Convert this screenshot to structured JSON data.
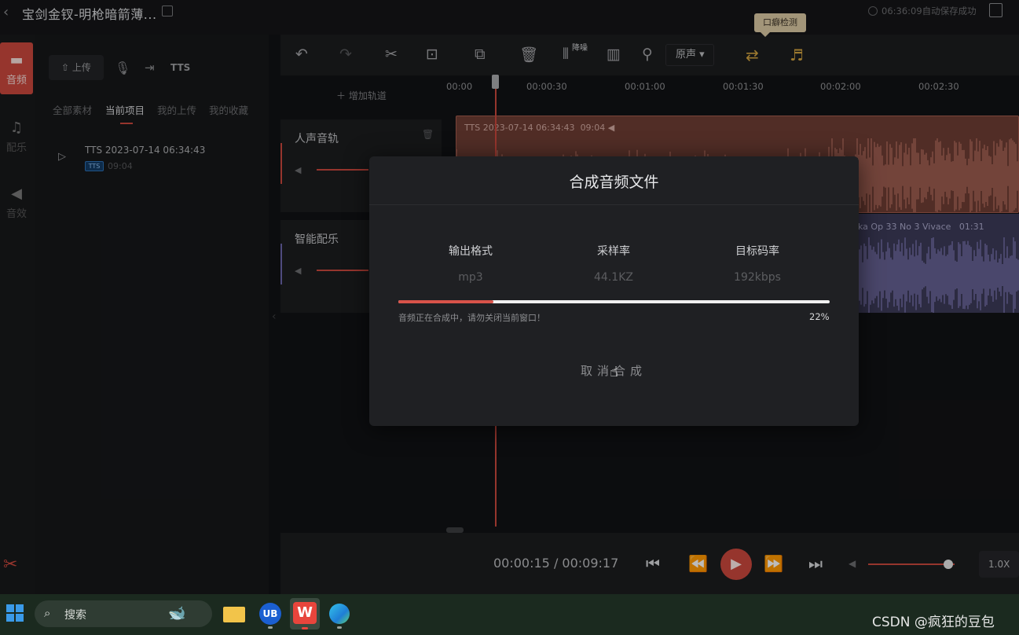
{
  "header": {
    "title": "宝剑金钗-明枪暗箭薄...",
    "save_status": "06:36:09自动保存成功"
  },
  "leftnav": {
    "items": [
      {
        "label": "音频",
        "icon": "folder-icon"
      },
      {
        "label": "配乐",
        "icon": "music-note-icon"
      },
      {
        "label": "音效",
        "icon": "speaker-icon"
      }
    ]
  },
  "media": {
    "upload_label": "上传",
    "tts_label": "TTS",
    "tabs": [
      "全部素材",
      "当前项目",
      "我的上传",
      "我的收藏"
    ],
    "active_tab": "当前项目",
    "item": {
      "name": "TTS 2023-07-14 06:34:43",
      "tag": "TTS",
      "duration": "09:04"
    }
  },
  "toolbar": {
    "denoise_label": "降噪",
    "voice_select": "原声",
    "lipcheck_tip": "口癖检测"
  },
  "timeline": {
    "add_track_label": "增加轨道",
    "ticks": [
      "00:00",
      "00:00:30",
      "00:01:00",
      "00:01:30",
      "00:02:00",
      "00:02:30"
    ],
    "tracks": [
      {
        "name": "人声音轨"
      },
      {
        "name": "智能配乐"
      }
    ],
    "clips": {
      "voice_label": "TTS 2023-07-14 06:34:43",
      "voice_duration": "09:04",
      "music_label": "ka Op 33 No 3 Vivace",
      "music_duration": "01:31"
    }
  },
  "player": {
    "current_time": "00:00:15",
    "separator": " / ",
    "total_time": "00:09:17",
    "speed": "1.0X",
    "volume": 0.93
  },
  "modal": {
    "title": "合成音频文件",
    "columns": [
      {
        "header": "输出格式",
        "value": "mp3"
      },
      {
        "header": "采样率",
        "value": "44.1KZ"
      },
      {
        "header": "目标码率",
        "value": "192kbps"
      }
    ],
    "progress": 0.22,
    "progress_percent": "22%",
    "message": "音频正在合成中，请勿关闭当前窗口！",
    "cancel_label": "取消合成"
  },
  "taskbar": {
    "search_label": "搜索",
    "watermark": "CSDN @疯狂的豆包"
  },
  "colors": {
    "accent": "#c8473c",
    "voice_wave": "#c77a6a",
    "music_wave": "#8c85c9"
  }
}
